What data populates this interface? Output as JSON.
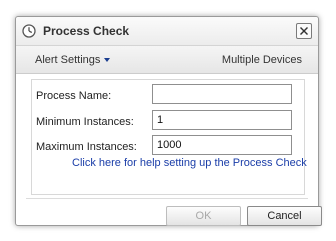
{
  "dialog": {
    "title": "Process Check",
    "close_label": "X"
  },
  "toolbar": {
    "alert_settings_label": "Alert Settings",
    "multiple_devices_label": "Multiple Devices"
  },
  "form": {
    "process_name": {
      "label": "Process Name:",
      "value": ""
    },
    "minimum_instances": {
      "label": "Minimum Instances:",
      "value": "1"
    },
    "maximum_instances": {
      "label": "Maximum Instances:",
      "value": "1000"
    },
    "help_link": "Click here for help setting up the Process Check"
  },
  "buttons": {
    "ok_label": "OK",
    "ok_enabled": false,
    "cancel_label": "Cancel"
  },
  "icons": {
    "title": "clock-icon",
    "close": "close-icon",
    "alert_settings": "chevron-down-icon"
  },
  "colors": {
    "link": "#1a3da8",
    "dropdown_arrow": "#1a3d8f",
    "disabled_text": "#a8a8a8"
  }
}
